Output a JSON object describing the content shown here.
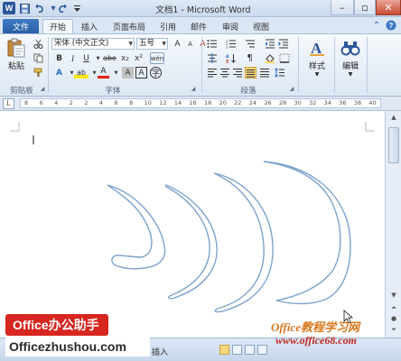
{
  "window": {
    "title": "文档1 - Microsoft Word",
    "app_icon": "W",
    "quick_access": [
      "save-icon",
      "undo-icon",
      "redo-icon",
      "customize-icon"
    ],
    "controls": [
      "minimize",
      "restore",
      "close"
    ],
    "controls_glyphs": {
      "minimize": "–",
      "restore": "▫",
      "close": "✕"
    }
  },
  "ribbon": {
    "tabs": [
      {
        "label": "文件",
        "kind": "file"
      },
      {
        "label": "开始",
        "active": true
      },
      {
        "label": "插入"
      },
      {
        "label": "页面布局"
      },
      {
        "label": "引用"
      },
      {
        "label": "邮件"
      },
      {
        "label": "审阅"
      },
      {
        "label": "视图"
      }
    ],
    "groups": {
      "clipboard": {
        "label": "剪贴板",
        "paste_label": "粘贴"
      },
      "font": {
        "label": "字体",
        "font_name": "宋体 (中文正文)",
        "font_size": "五号",
        "bold": "B",
        "italic": "I",
        "underline": "U",
        "strike": "abe",
        "subscript": "x₂",
        "superscript": "x²",
        "text_effects": "A",
        "highlight": "ab",
        "font_color": "A",
        "grow": "A",
        "shrink": "A",
        "char_shading": "A",
        "char_border": "A",
        "wen": "wén",
        "clear_format": "A"
      },
      "paragraph": {
        "label": "段落"
      },
      "styles": {
        "label": "样式"
      },
      "editing": {
        "label": "编辑"
      }
    },
    "accent": "#2b579a"
  },
  "ruler": {
    "numbers": [
      "8",
      "6",
      "4",
      "2",
      "2",
      "4",
      "6",
      "8",
      "10",
      "12",
      "14",
      "16",
      "18",
      "20",
      "22",
      "24",
      "26",
      "28",
      "30",
      "32",
      "34",
      "36",
      "38",
      "40"
    ],
    "tab_selector": "L"
  },
  "status": {
    "insert_mode": "插入"
  },
  "watermark": {
    "badge": "Office办公助手",
    "url": "Officezhushou.com",
    "right_top": "Office教程学习网",
    "right_bottom": "www.office68.com"
  }
}
